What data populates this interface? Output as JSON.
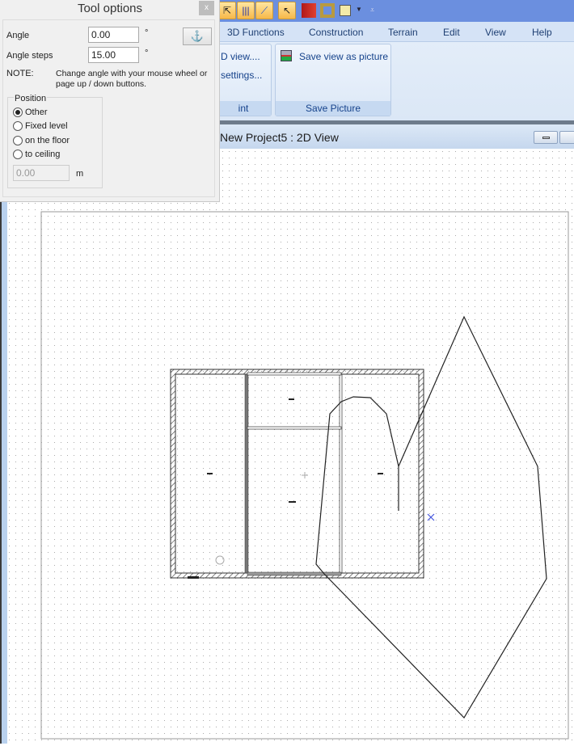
{
  "tool_options": {
    "title": "Tool options",
    "close": "x",
    "angle_label": "Angle",
    "angle_value": "0.00",
    "angle_unit": "°",
    "steps_label": "Angle steps",
    "steps_value": "15.00",
    "steps_unit": "°",
    "note_label": "NOTE:",
    "note_text": "Change angle with your mouse wheel or page up / down buttons.",
    "position_label": "Position",
    "options": [
      "Other",
      "Fixed level",
      "on the floor",
      "to ceiling"
    ],
    "selected": "Other",
    "level_value": "0.00",
    "level_unit": "m"
  },
  "menu": [
    "3D Functions",
    "Construction",
    "Terrain",
    "Edit",
    "View",
    "Help"
  ],
  "ribbon": {
    "partial_item1": "D view....",
    "partial_item2": "settings...",
    "partial_group": "int",
    "save_view": "Save view as picture",
    "save_group": "Save Picture"
  },
  "document": {
    "title": "New Project5 : 2D View"
  }
}
